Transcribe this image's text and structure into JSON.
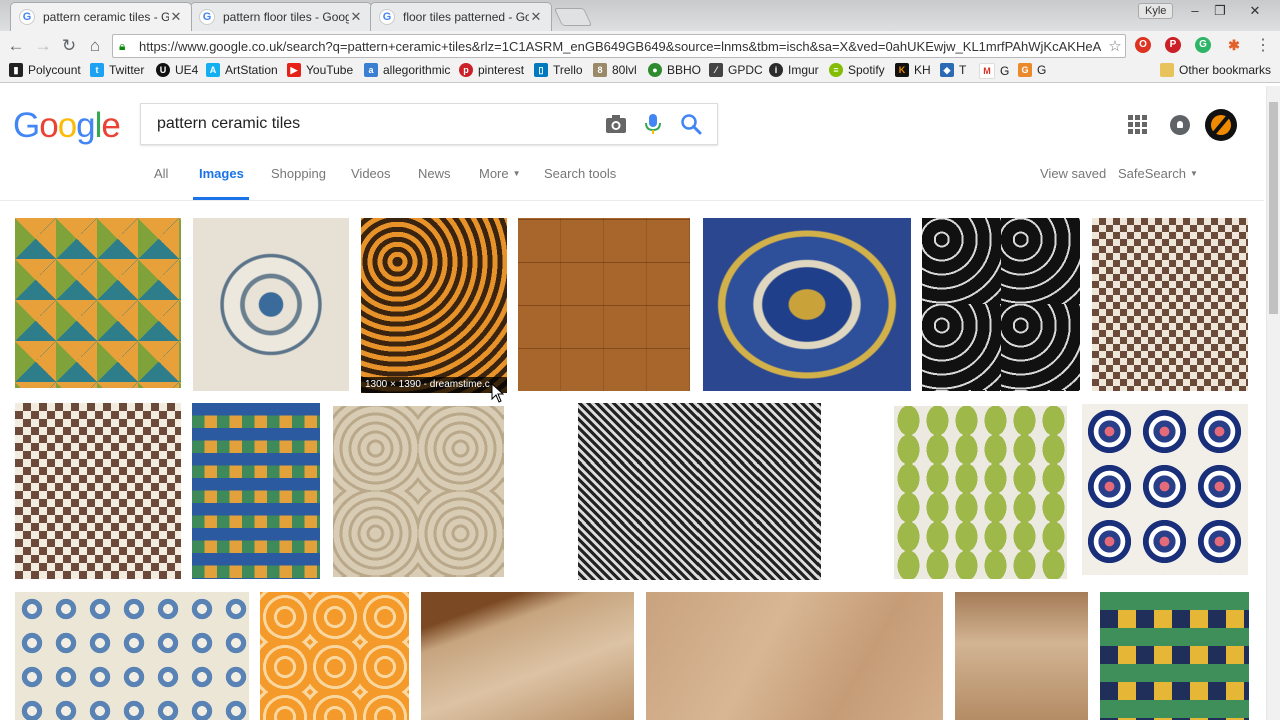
{
  "tabs": [
    {
      "label": "pattern ceramic tiles - Go",
      "active": true
    },
    {
      "label": "pattern floor tiles - Goog",
      "active": false
    },
    {
      "label": "floor tiles patterned - Go",
      "active": false
    }
  ],
  "window": {
    "profile_name": "Kyle"
  },
  "toolbar": {
    "url": "https://www.google.co.uk/search?q=pattern+ceramic+tiles&rlz=1C1ASRM_enGB649GB649&source=lnms&tbm=isch&sa=X&ved=0ahUKEwjw_KL1mrfPAhWjKcAKHeA"
  },
  "bookmarks": [
    {
      "label": "Polycount",
      "color": "#222222"
    },
    {
      "label": "Twitter",
      "color": "#1da1f2"
    },
    {
      "label": "UE4",
      "color": "#111111"
    },
    {
      "label": "ArtStation",
      "color": "#13aff0"
    },
    {
      "label": "YouTube",
      "color": "#e62117"
    },
    {
      "label": "allegorithmic",
      "color": "#3a7fd1"
    },
    {
      "label": "pinterest",
      "color": "#cb2027"
    },
    {
      "label": "Trello",
      "color": "#0079bf"
    },
    {
      "label": "80lvl",
      "color": "#9a8a6a"
    },
    {
      "label": "BBHO",
      "color": "#2e8b2e"
    },
    {
      "label": "GPDC",
      "color": "#444444"
    },
    {
      "label": "Imgur",
      "color": "#2c2c2c"
    },
    {
      "label": "Spotify",
      "color": "#84bd00"
    },
    {
      "label": "KH",
      "color": "#111111"
    },
    {
      "label": "T",
      "color": "#2d6ab4"
    },
    {
      "label": "G",
      "color": "#d93025"
    },
    {
      "label": "G",
      "color": "#ea8a2a"
    }
  ],
  "other_bookmarks": "Other bookmarks",
  "google": {
    "logo": [
      "G",
      "o",
      "o",
      "g",
      "l",
      "e"
    ],
    "logo_colors": [
      "#4285f4",
      "#ea4335",
      "#fbbc05",
      "#4285f4",
      "#34a853",
      "#ea4335"
    ],
    "query": "pattern ceramic tiles"
  },
  "nav": {
    "all": "All",
    "images": "Images",
    "shopping": "Shopping",
    "videos": "Videos",
    "news": "News",
    "more": "More",
    "search_tools": "Search tools",
    "view_saved": "View saved",
    "safesearch": "SafeSearch"
  },
  "hover_caption": "1300 × 1390 - dreamstime.c",
  "colors": {
    "accent": "#1a73e8"
  }
}
